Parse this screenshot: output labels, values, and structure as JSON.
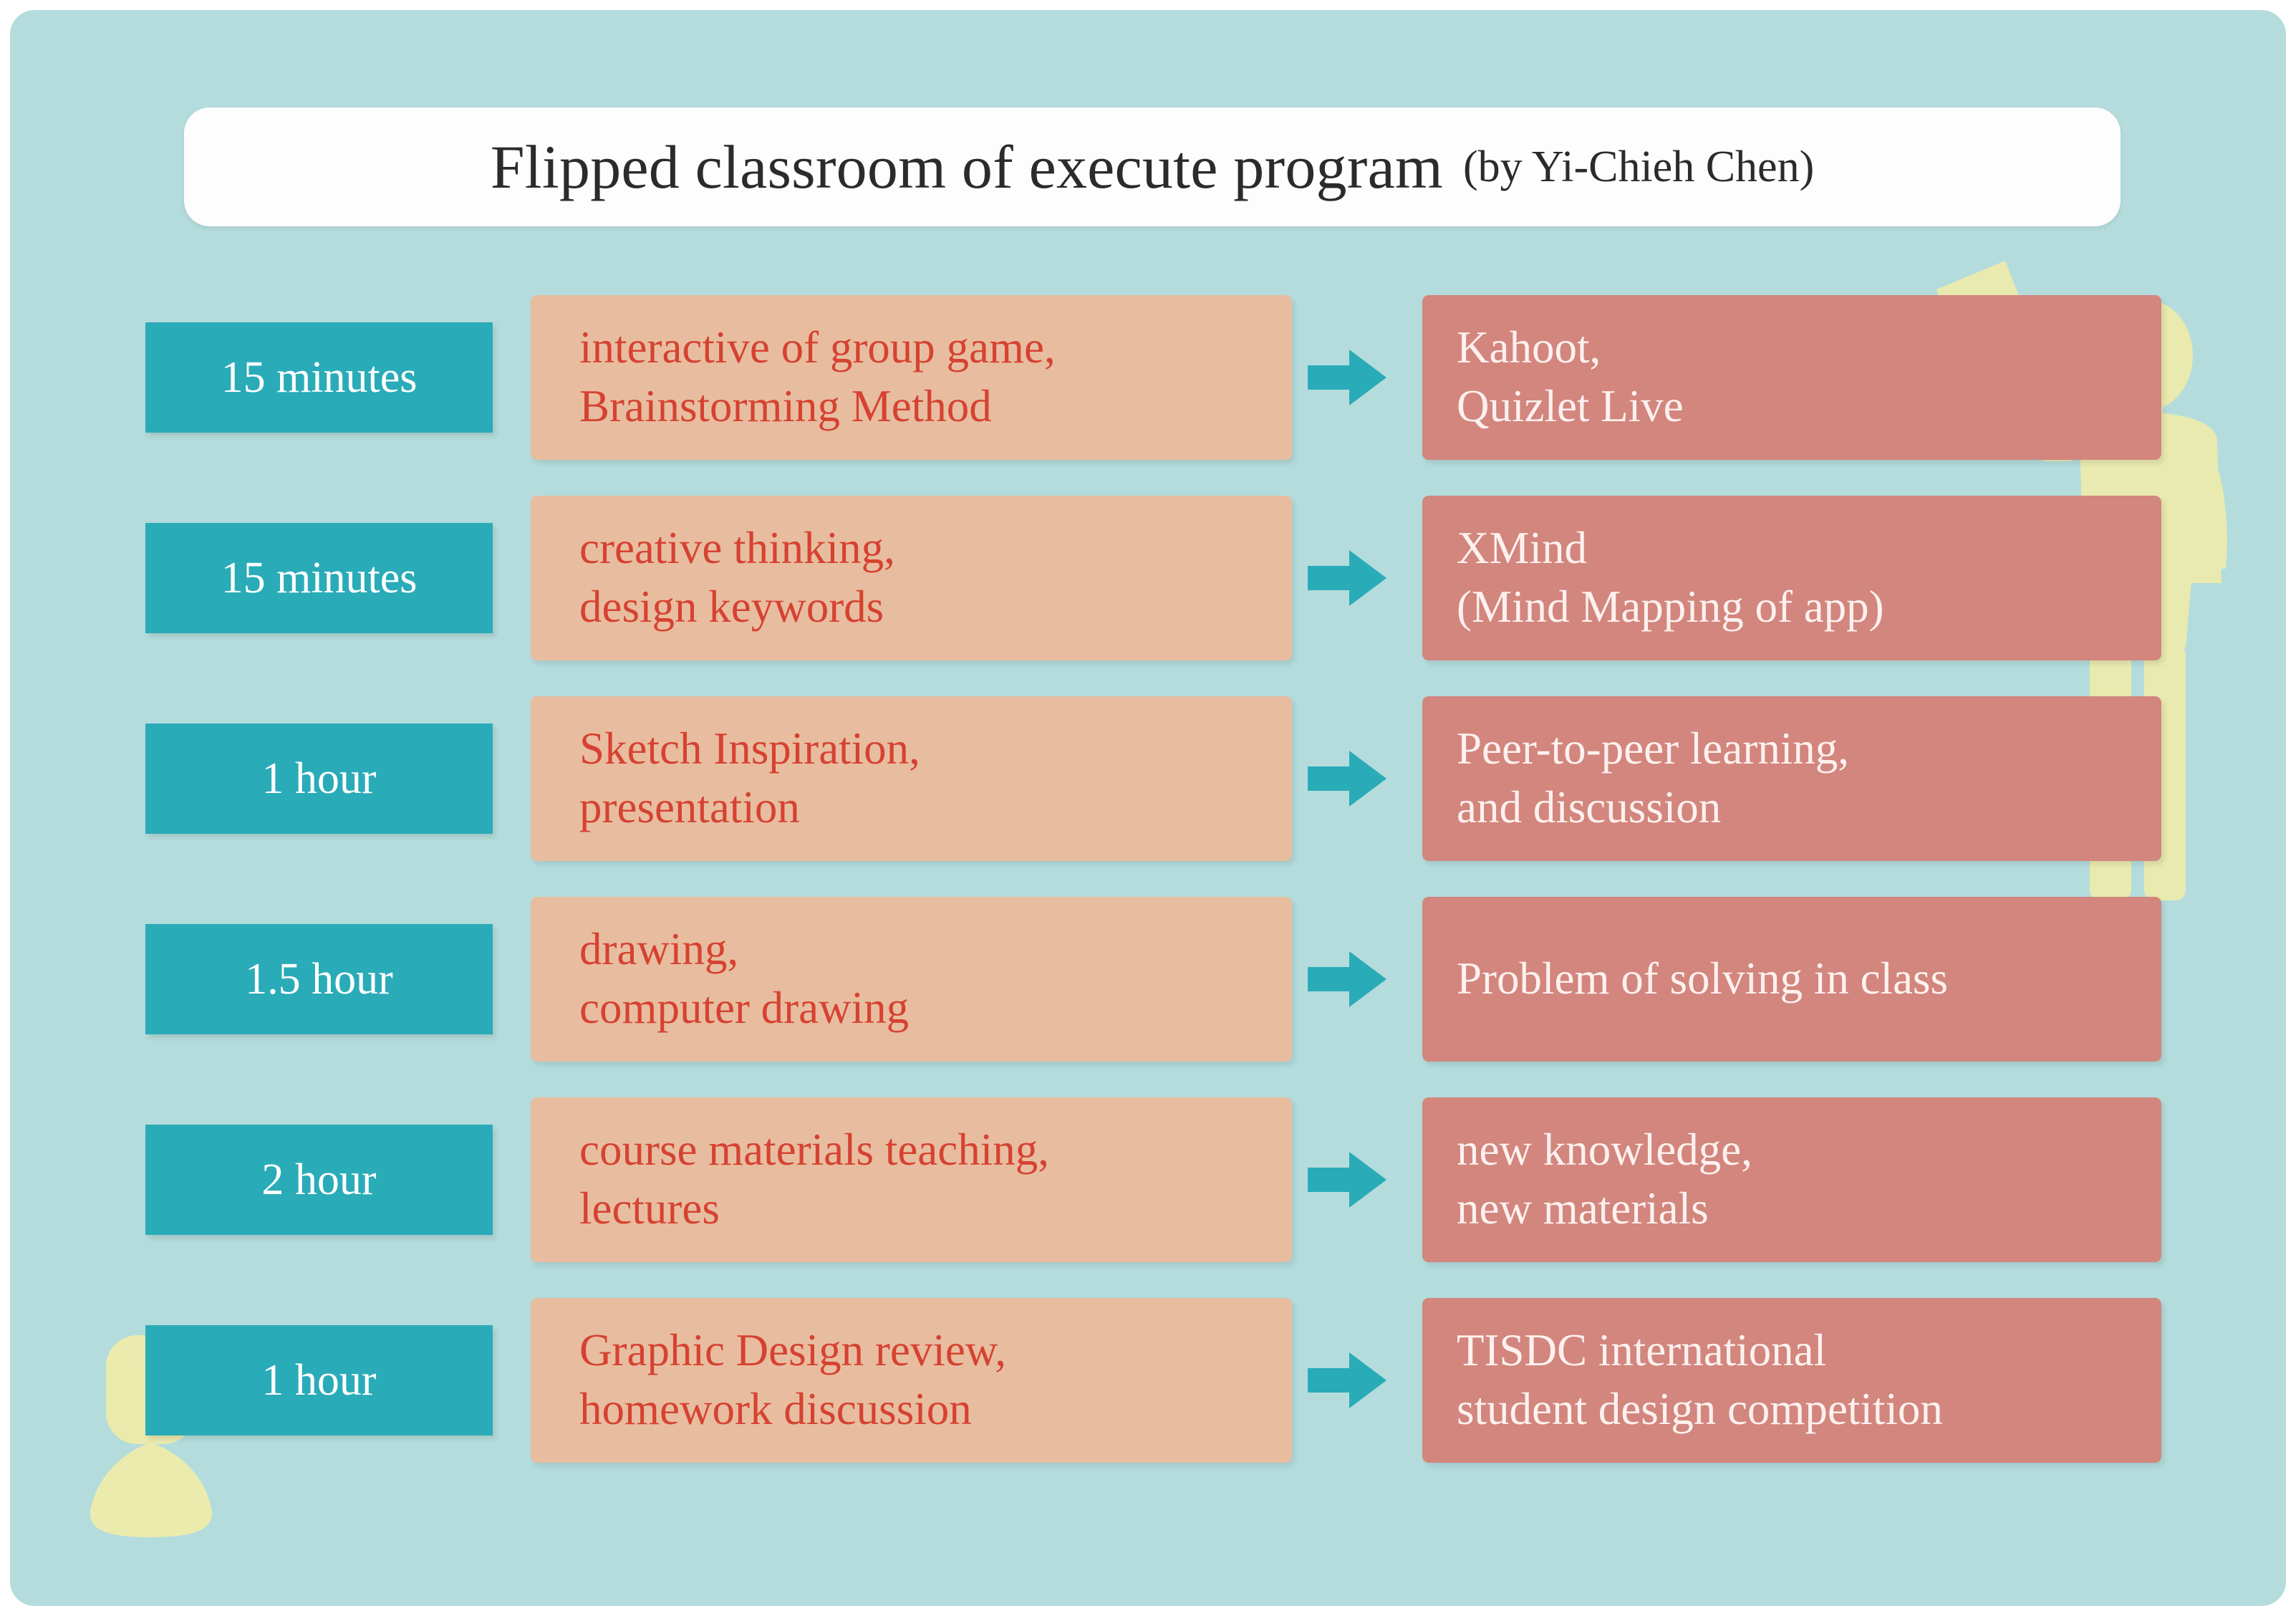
{
  "header": {
    "title": "Flipped classroom of execute program",
    "author": "(by Yi-Chieh Chen)"
  },
  "colors": {
    "background": "#b4dcdc",
    "title_bar": "#fdfdfd",
    "duration_box": "#2aabb8",
    "duration_text": "#ffffff",
    "activity_box": "#e8bd9f",
    "activity_text": "#d64232",
    "outcome_box": "#d2867e",
    "outcome_text": "#fdf1ee",
    "arrow": "#2aabb8",
    "figure": "#f0eba8"
  },
  "rows": [
    {
      "duration": "15 minutes",
      "activity": [
        "interactive of group game,",
        "Brainstorming Method"
      ],
      "outcome": [
        "Kahoot,",
        "Quizlet Live"
      ]
    },
    {
      "duration": "15 minutes",
      "activity": [
        "creative thinking,",
        "design keywords"
      ],
      "outcome": [
        "XMind",
        "(Mind Mapping of app)"
      ]
    },
    {
      "duration": "1 hour",
      "activity": [
        "Sketch Inspiration,",
        "presentation"
      ],
      "outcome": [
        "Peer-to-peer learning,",
        "and discussion"
      ]
    },
    {
      "duration": "1.5 hour",
      "activity": [
        "drawing,",
        "computer drawing"
      ],
      "outcome": [
        "Problem of solving in class"
      ]
    },
    {
      "duration": "2 hour",
      "activity": [
        "course materials teaching,",
        "lectures"
      ],
      "outcome": [
        "new knowledge,",
        "new materials"
      ]
    },
    {
      "duration": "1 hour",
      "activity": [
        "Graphic Design review,",
        "homework discussion"
      ],
      "outcome": [
        "TISDC international",
        "student design competition"
      ]
    }
  ],
  "icons": {
    "arrow": "right-arrow-icon",
    "standing_figure": "standing-person-holding-paper-icon",
    "seated_figure": "seated-person-icon"
  }
}
